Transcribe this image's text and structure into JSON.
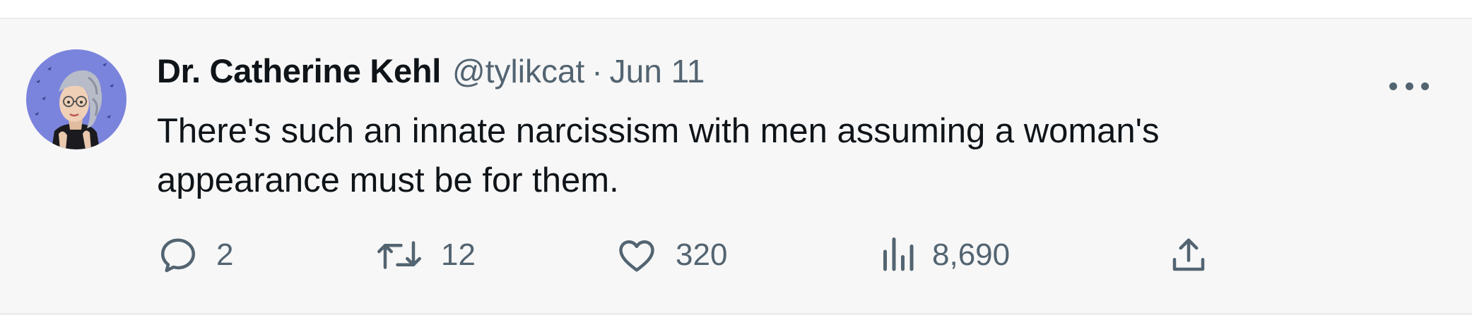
{
  "tweet": {
    "author": {
      "display_name": "Dr. Catherine Kehl",
      "handle": "@tylikcat",
      "avatar_icon": "avatar-illustration"
    },
    "separator": "·",
    "date": "Jun 11",
    "text": "There's such an innate narcissism with men assuming a woman's appearance must be for them.",
    "more_icon": "more-horizontal-icon",
    "actions": {
      "reply": {
        "icon": "reply-icon",
        "count": "2"
      },
      "retweet": {
        "icon": "retweet-icon",
        "count": "12"
      },
      "like": {
        "icon": "heart-icon",
        "count": "320"
      },
      "views": {
        "icon": "views-chart-icon",
        "count": "8,690"
      },
      "share": {
        "icon": "share-icon"
      }
    }
  },
  "colors": {
    "background": "#f7f7f7",
    "primary_text": "#0f1419",
    "secondary_text": "#536471",
    "avatar_bg": "#7b84dc"
  }
}
